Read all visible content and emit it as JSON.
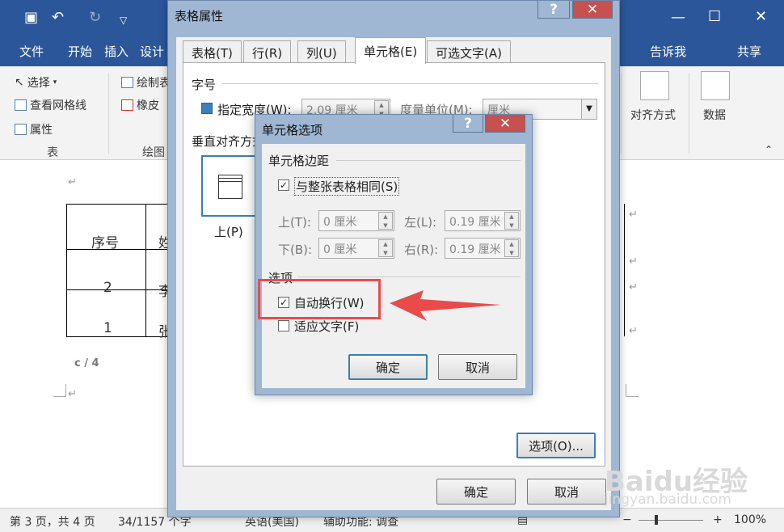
{
  "word": {
    "tabs": [
      "文件",
      "开始",
      "插入",
      "设计",
      "告诉我",
      "共享"
    ],
    "ribbon": {
      "select": "选择",
      "view_gridlines": "查看网格线",
      "properties": "属性",
      "group_table": "表",
      "draw": "绘制表",
      "eraser": "橡皮",
      "group_draw": "绘图",
      "alignment": "对齐方式",
      "data": "数据"
    },
    "doc": {
      "cell_seq": "序号",
      "cell_name_partial": "姓",
      "row2_num": "2",
      "row2_name": "李",
      "row1_num": "1",
      "row1_name": "张",
      "page_marker": "c / 4"
    },
    "status": {
      "page": "第 3 页，共 4 页",
      "words": "34/1157 个字",
      "lang": "英语(美国)",
      "accessibility": "辅助功能: 调查",
      "zoom": "100%"
    }
  },
  "table_dialog": {
    "title": "表格属性",
    "help": "?",
    "close": "✕",
    "tabs": [
      "表格(T)",
      "行(R)",
      "列(U)",
      "单元格(E)",
      "可选文字(A)"
    ],
    "size_section": "字号",
    "specify_width": "指定宽度(W):",
    "width_value": "2.09 厘米",
    "unit_label": "度量单位(M):",
    "unit_value": "厘米",
    "valign_section": "垂直对齐方式",
    "valign_top": "上(P)",
    "options_button": "选项(O)...",
    "ok": "确定",
    "cancel": "取消"
  },
  "cell_options_dialog": {
    "title": "单元格选项",
    "help": "?",
    "close": "✕",
    "margins_section": "单元格边距",
    "same_as_table": "与整张表格相同(S)",
    "top": "上(T):",
    "top_value": "0 厘米",
    "left": "左(L):",
    "left_value": "0.19 厘米",
    "bottom": "下(B):",
    "bottom_value": "0 厘米",
    "right": "右(R):",
    "right_value": "0.19 厘米",
    "options_section": "选项",
    "wrap_text": "自动换行(W)",
    "fit_text": "适应文字(F)",
    "ok": "确定",
    "cancel": "取消",
    "checkmark": "✓"
  },
  "watermark": {
    "brand": "Baidu经验",
    "url": "jingyan.baidu.com"
  },
  "colors": {
    "word_blue": "#2b579a",
    "highlight_red": "#e94b4b",
    "dialog_frame": "#9fb7d3"
  }
}
